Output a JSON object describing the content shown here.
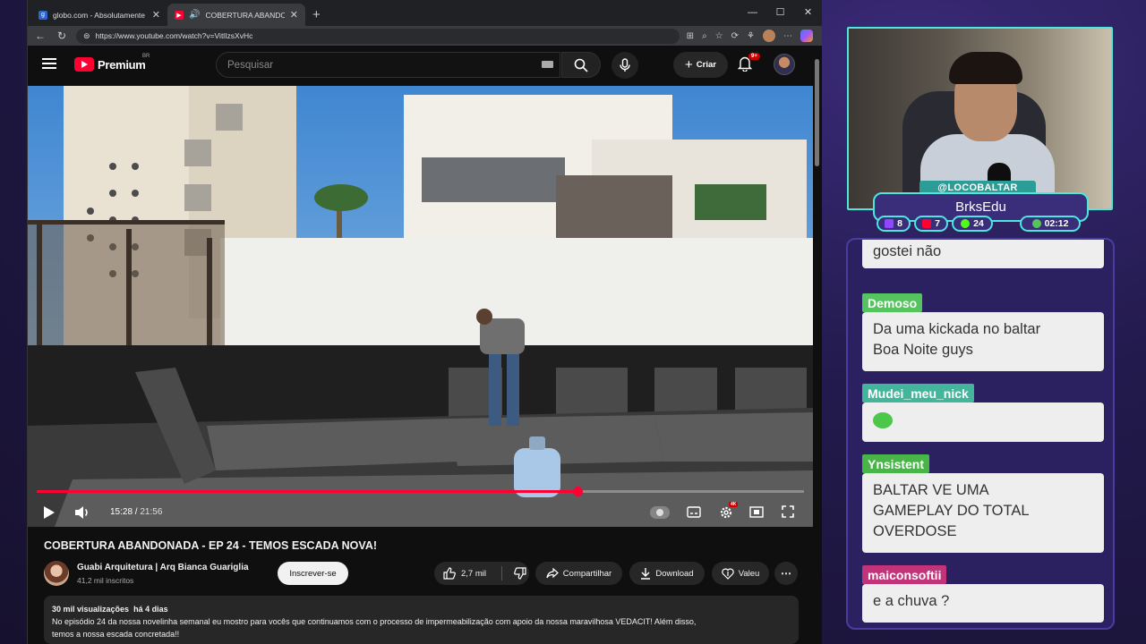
{
  "browser": {
    "tabs": [
      {
        "title": "globo.com - Absolutamente tudo",
        "favicon": "g"
      },
      {
        "title": "COBERTURA ABANDONADA",
        "favicon": "yt"
      }
    ],
    "url": "https://www.youtube.com/watch?v=VitlIzsXvHc"
  },
  "youtube": {
    "logo_text": "Premium",
    "logo_region": "BR",
    "search_placeholder": "Pesquisar",
    "create_label": "Criar",
    "notification_badge": "9+"
  },
  "player": {
    "current_time": "15:28",
    "duration": "21:56",
    "progress_fraction": 0.705,
    "time_separator": " / ",
    "settings_badge": "4K"
  },
  "video": {
    "title": "COBERTURA ABANDONADA - EP 24 - TEMOS ESCADA NOVA!",
    "channel_name": "Guabi Arquitetura | Arq Bianca Guariglia",
    "subscribers": "41,2 mil inscritos",
    "subscribe_label": "Inscrever-se",
    "likes": "2,7 mil",
    "share_label": "Compartilhar",
    "download_label": "Download",
    "thanks_label": "Valeu",
    "views": "30 mil visualizações",
    "age": "há 4 dias",
    "description_line1": "No episódio 24 da nossa novelinha semanal eu mostro para vocês que continuamos com o processo de impermeabilização com apoio da nossa maravilhosa VEDACIT! Além disso,",
    "description_line2": "temos a nossa escada concretada!!"
  },
  "stream_overlay": {
    "handle": "@LOCOBALTAR",
    "name": "BrksEdu",
    "stats": [
      {
        "icon": "twitch-icon",
        "value": "8"
      },
      {
        "icon": "youtube-icon",
        "value": "7"
      },
      {
        "icon": "kick-icon",
        "value": "24"
      },
      {
        "icon": "clock-icon",
        "value": "02:12"
      }
    ]
  },
  "chat": {
    "partial_message": "gostei não",
    "messages": [
      {
        "user": "Demoso",
        "text_lines": [
          "Da uma kickada no baltar",
          "Boa Noite guys"
        ],
        "color": "#56c45e"
      },
      {
        "user": "Mudei_meu_nick",
        "text_lines": [
          "🐸"
        ],
        "color": "#43b59a"
      },
      {
        "user": "Ynsistent",
        "text_lines": [
          "BALTAR VE UMA",
          "GAMEPLAY DO TOTAL",
          "OVERDOSE"
        ],
        "color": "#49b548"
      },
      {
        "user": "maiconsoftii",
        "text_lines": [
          "e a chuva ?"
        ],
        "color": "#c2337a"
      }
    ]
  }
}
